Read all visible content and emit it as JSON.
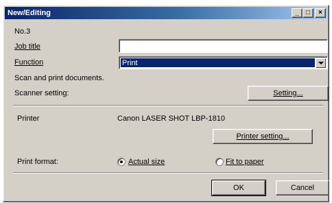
{
  "window": {
    "title": "New/Editing",
    "controls": {
      "minimize": "_",
      "maximize": "□",
      "close": "×"
    }
  },
  "form": {
    "number": "No.3",
    "job_title_label": "Job title",
    "job_title_value": "",
    "function_label": "Function",
    "function_value": "Print",
    "function_description": "Scan and print documents.",
    "scanner_setting_label": "Scanner setting:",
    "setting_button": "Setting...",
    "printer_label": "Printer",
    "printer_value": "Canon LASER SHOT LBP-1810",
    "printer_setting_button": "Printer setting...",
    "print_format_label": "Print format:",
    "options": [
      {
        "label": "Actual size",
        "selected": true
      },
      {
        "label": "Fit to paper",
        "selected": false
      }
    ]
  },
  "footer": {
    "ok_label": "OK",
    "cancel_label": "Cancel"
  }
}
